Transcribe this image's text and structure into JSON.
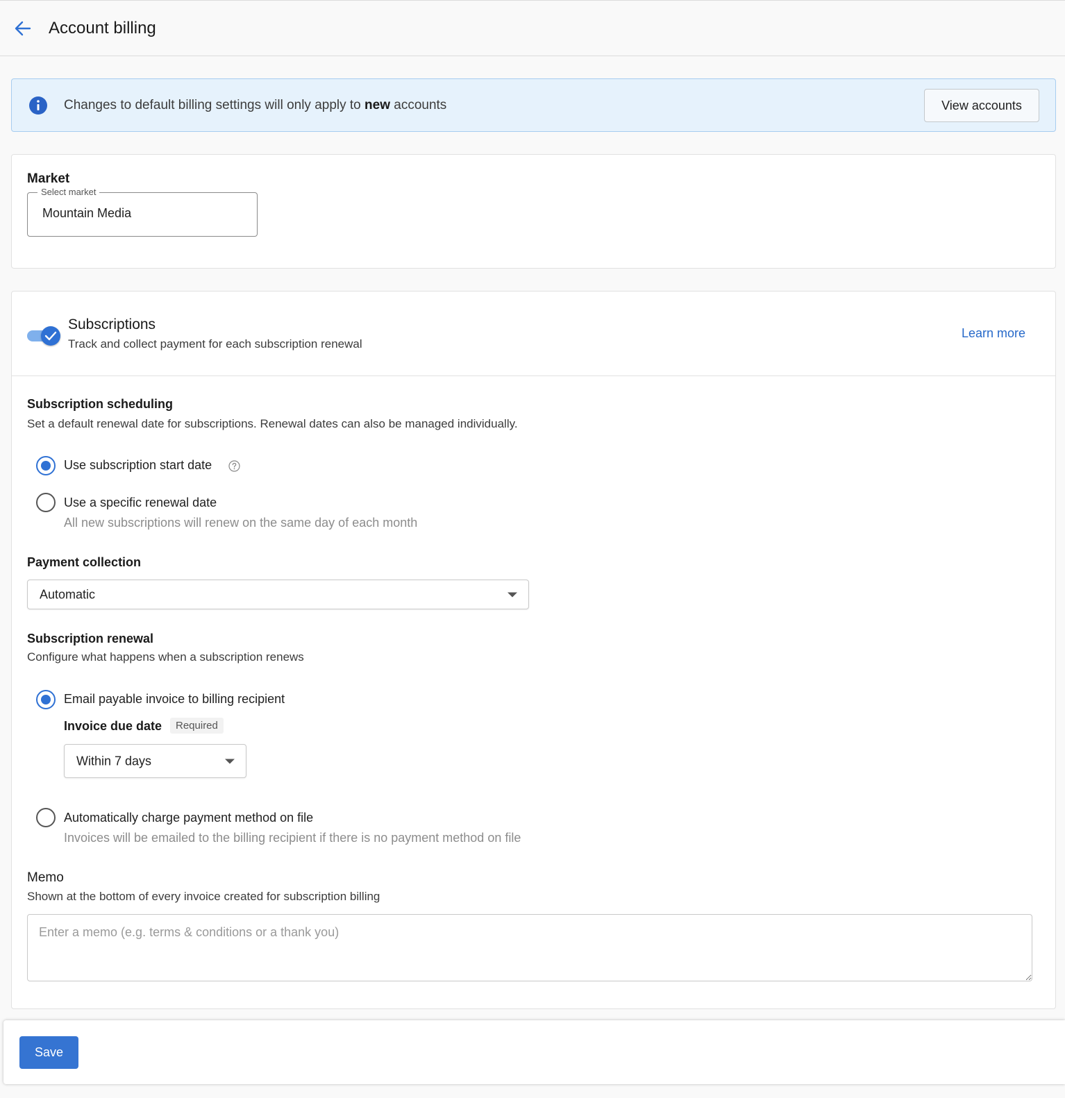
{
  "header": {
    "title": "Account billing"
  },
  "banner": {
    "text_before": "Changes to default billing settings will only apply to ",
    "text_bold": "new",
    "text_after": " accounts",
    "button_label": "View accounts"
  },
  "market": {
    "label": "Market",
    "field_legend": "Select market",
    "value": "Mountain Media"
  },
  "subscriptions": {
    "enabled": true,
    "title": "Subscriptions",
    "description": "Track and collect payment for each subscription renewal",
    "learn_more": "Learn more"
  },
  "scheduling": {
    "title": "Subscription scheduling",
    "description": "Set a default renewal date for subscriptions. Renewal dates can also be managed individually.",
    "options": [
      {
        "label": "Use subscription start date",
        "checked": true
      },
      {
        "label": "Use a specific renewal date",
        "sublabel": "All new subscriptions will renew on the same day of each month",
        "checked": false
      }
    ]
  },
  "payment_collection": {
    "title": "Payment collection",
    "value": "Automatic"
  },
  "renewal": {
    "title": "Subscription renewal",
    "description": "Configure what happens when a subscription renews",
    "options": [
      {
        "label": "Email payable invoice to billing recipient",
        "checked": true
      },
      {
        "label": "Automatically charge payment method on file",
        "sublabel": "Invoices will be emailed to the billing recipient if there is no payment method on file",
        "checked": false
      }
    ],
    "due_date_label": "Invoice due date",
    "required_badge": "Required",
    "due_date_value": "Within 7 days"
  },
  "memo": {
    "title": "Memo",
    "description": "Shown at the bottom of every invoice created for subscription billing",
    "placeholder": "Enter a memo (e.g. terms & conditions or a thank you)"
  },
  "footer": {
    "save_label": "Save"
  },
  "colors": {
    "accent": "#2f71d4",
    "banner_bg": "#e6f2fc",
    "link": "#2669c9"
  }
}
